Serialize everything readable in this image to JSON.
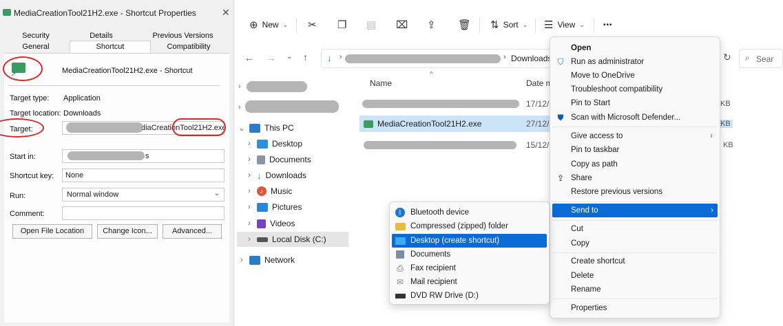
{
  "dialog": {
    "title": "MediaCreationTool21H2.exe - Shortcut Properties",
    "close": "✕",
    "tabs_row1": [
      "Security",
      "Details",
      "Previous Versions"
    ],
    "tabs_row2": [
      "General",
      "Shortcut",
      "Compatibility"
    ],
    "active_tab": "Shortcut",
    "shortcut_name": "MediaCreationTool21H2.exe - Shortcut",
    "target_type_label": "Target type:",
    "target_type_value": "Application",
    "target_location_label": "Target location:",
    "target_location_value": "Downloads",
    "target_label": "Target:",
    "target_value_visible": "diaCreationTool21H2.exe",
    "start_in_label": "Start in:",
    "start_in_value_visible": "s",
    "shortcut_key_label": "Shortcut key:",
    "shortcut_key_value": "None",
    "run_label": "Run:",
    "run_value": "Normal window",
    "comment_label": "Comment:",
    "comment_value": "",
    "buttons": [
      "Open File Location",
      "Change Icon...",
      "Advanced..."
    ],
    "annotation_color": "#d42a2a"
  },
  "toolbar": {
    "new_label": "New",
    "sort_label": "Sort",
    "view_label": "View",
    "more": "•••"
  },
  "address": {
    "crumb_right": "Downloads",
    "search_placeholder": "Sear"
  },
  "nav": {
    "this_pc": "This PC",
    "items": [
      "Desktop",
      "Documents",
      "Downloads",
      "Music",
      "Pictures",
      "Videos",
      "Local Disk (C:)"
    ],
    "network": "Network"
  },
  "files": {
    "col_name": "Name",
    "col_date": "Date m",
    "rows": [
      {
        "name": "",
        "date": "17/12/",
        "size": "KB"
      },
      {
        "name": "MediaCreationTool21H2.exe",
        "date": "27/12/",
        "size": "KB"
      },
      {
        "name": "",
        "date": "15/12/",
        "size": "KB"
      }
    ],
    "selected_color": "#cce4f7"
  },
  "context_menu": {
    "items": [
      {
        "label": "Open",
        "bold": true,
        "icon": ""
      },
      {
        "label": "Run as administrator",
        "icon": "shield-icon"
      },
      {
        "label": "Move to OneDrive",
        "icon": ""
      },
      {
        "label": "Troubleshoot compatibility",
        "icon": ""
      },
      {
        "label": "Pin to Start",
        "icon": ""
      },
      {
        "label": "Scan with Microsoft Defender...",
        "icon": "defender-icon"
      },
      {
        "label": "Give access to",
        "icon": "",
        "submenu": true
      },
      {
        "label": "Pin to taskbar",
        "icon": ""
      },
      {
        "label": "Copy as path",
        "icon": ""
      },
      {
        "label": "Share",
        "icon": "share-icon"
      },
      {
        "label": "Restore previous versions",
        "icon": ""
      },
      {
        "label": "Send to",
        "icon": "",
        "submenu": true,
        "highlighted": true
      },
      {
        "label": "Cut",
        "icon": ""
      },
      {
        "label": "Copy",
        "icon": ""
      },
      {
        "label": "Create shortcut",
        "icon": ""
      },
      {
        "label": "Delete",
        "icon": ""
      },
      {
        "label": "Rename",
        "icon": ""
      },
      {
        "label": "Properties",
        "icon": ""
      }
    ],
    "highlight_color": "#0a6ad6"
  },
  "send_to": {
    "items": [
      {
        "label": "Bluetooth device",
        "icon": "bluetooth-icon"
      },
      {
        "label": "Compressed (zipped) folder",
        "icon": "zip-folder-icon"
      },
      {
        "label": "Desktop (create shortcut)",
        "icon": "desktop-icon",
        "highlighted": true
      },
      {
        "label": "Documents",
        "icon": "documents-icon"
      },
      {
        "label": "Fax recipient",
        "icon": "fax-icon"
      },
      {
        "label": "Mail recipient",
        "icon": "mail-icon"
      },
      {
        "label": "DVD RW Drive (D:)",
        "icon": "dvd-drive-icon"
      }
    ]
  }
}
